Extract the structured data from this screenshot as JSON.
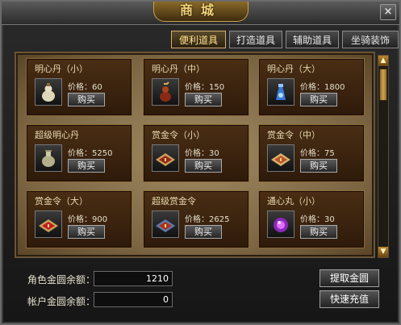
{
  "window": {
    "title": "商城"
  },
  "tabs": [
    {
      "label": "便利道具",
      "active": true
    },
    {
      "label": "打造道具",
      "active": false
    },
    {
      "label": "辅助道具",
      "active": false
    },
    {
      "label": "坐骑装饰",
      "active": false
    }
  ],
  "items": [
    {
      "name": "明心丹（小）",
      "price_label": "价格：60",
      "buy_label": "购买",
      "icon": "gourd-bottle-icon"
    },
    {
      "name": "明心丹（中）",
      "price_label": "价格：150",
      "buy_label": "购买",
      "icon": "red-gourd-icon"
    },
    {
      "name": "明心丹（大）",
      "price_label": "价格：1800",
      "buy_label": "购买",
      "icon": "blue-flask-icon"
    },
    {
      "name": "超级明心丹",
      "price_label": "价格：5250",
      "buy_label": "购买",
      "icon": "gold-vase-icon"
    },
    {
      "name": "赏金令（小）",
      "price_label": "价格：30",
      "buy_label": "购买",
      "icon": "bounty-scroll-icon"
    },
    {
      "name": "赏金令（中）",
      "price_label": "价格：75",
      "buy_label": "购买",
      "icon": "bounty-scroll-icon"
    },
    {
      "name": "赏金令（大）",
      "price_label": "价格：900",
      "buy_label": "购买",
      "icon": "bounty-scroll-icon"
    },
    {
      "name": "超级赏金令",
      "price_label": "价格：2625",
      "buy_label": "购买",
      "icon": "bounty-scroll-blue-icon"
    },
    {
      "name": "通心丸（小）",
      "price_label": "价格：30",
      "buy_label": "购买",
      "icon": "purple-orb-icon"
    }
  ],
  "footer": {
    "character_gold_label": "角色金圆余额：",
    "character_gold_value": "1210",
    "account_gold_label": "帐户金圆余额：",
    "account_gold_value": "0",
    "withdraw_label": "提取金圆",
    "recharge_label": "快速充值"
  },
  "scrollbar": {
    "up_arrow": "▲",
    "down_arrow": "▼"
  },
  "close_label": "×"
}
